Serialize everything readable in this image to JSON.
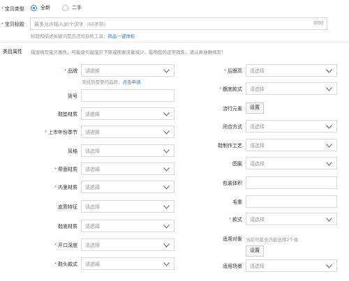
{
  "item_type": {
    "label": "宝贝类型",
    "options": [
      "全新",
      "二手"
    ],
    "selected": "全新"
  },
  "item_title": {
    "label": "宝贝标题",
    "placeholder": "最多允许输入30个汉字（60字符）",
    "counter": "0/60",
    "hint_text": "标题和描述关键词是否违规自检工具：",
    "hint_link": "商品一键体检"
  },
  "category_attrs": {
    "label": "类目属性",
    "notice": "错误填写宝贝属性，可能会引起宝贝下架或搜索流量减少，影响您的正常销售，请认真准确填写！"
  },
  "select_placeholder": "请选择",
  "brand_hint": {
    "text": "未找到需要的品牌，",
    "link": "点击申请"
  },
  "set_label": "设置",
  "left_fields": [
    {
      "label": "品牌",
      "required": true,
      "type": "select"
    },
    {
      "label": "货号",
      "required": false,
      "type": "input"
    },
    {
      "label": "鞋垫材质",
      "required": false,
      "type": "select"
    },
    {
      "label": "上市年份季节",
      "required": true,
      "type": "select"
    },
    {
      "label": "风格",
      "required": false,
      "type": "select"
    },
    {
      "label": "帮面材质",
      "required": true,
      "type": "select"
    },
    {
      "label": "内里材质",
      "required": true,
      "type": "select"
    },
    {
      "label": "皮质特征",
      "required": false,
      "type": "select"
    },
    {
      "label": "鞋底材质",
      "required": false,
      "type": "select"
    },
    {
      "label": "开口深度",
      "required": true,
      "type": "select"
    },
    {
      "label": "鞋头款式",
      "required": true,
      "type": "select"
    }
  ],
  "right_fields": [
    {
      "label": "后跟高",
      "required": true,
      "type": "select"
    },
    {
      "label": "跟底款式",
      "required": true,
      "type": "select"
    },
    {
      "label": "流行元素",
      "required": false,
      "type": "button"
    },
    {
      "label": "闭合方式",
      "required": false,
      "type": "select"
    },
    {
      "label": "鞋制作工艺",
      "required": false,
      "type": "select"
    },
    {
      "label": "图案",
      "required": false,
      "type": "select"
    },
    {
      "label": "包装体积",
      "required": false,
      "type": "input"
    },
    {
      "label": "毛重",
      "required": false,
      "type": "input"
    },
    {
      "label": "款式",
      "required": true,
      "type": "select"
    },
    {
      "label": "适用对象",
      "required": false,
      "type": "button",
      "note": "当前可最多只能选择2个值"
    },
    {
      "label": "适用场景",
      "required": false,
      "type": "select"
    }
  ]
}
